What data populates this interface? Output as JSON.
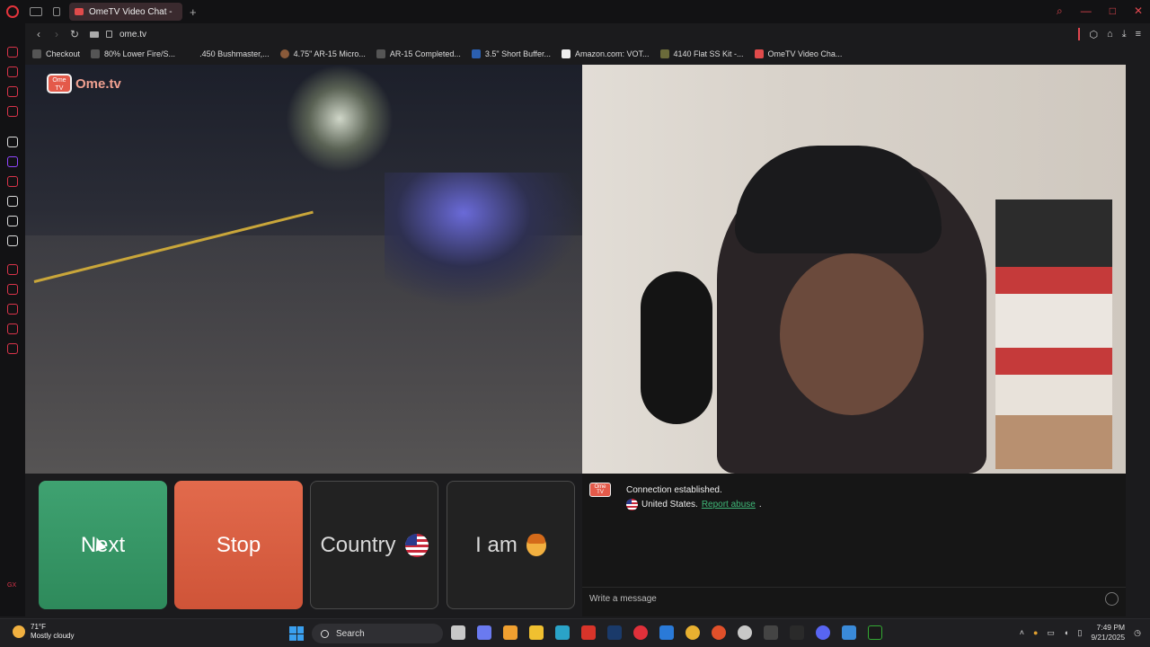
{
  "browser": {
    "tab_title": "OmeTV Video Chat -",
    "url": "ome.tv",
    "bookmarks": [
      {
        "label": "Checkout"
      },
      {
        "label": "80% Lower Fire/S..."
      },
      {
        "label": ".450 Bushmaster,..."
      },
      {
        "label": "4.75\" AR-15 Micro..."
      },
      {
        "label": "AR-15 Completed..."
      },
      {
        "label": "3.5\" Short Buffer..."
      },
      {
        "label": "Amazon.com: VOT..."
      },
      {
        "label": "4140 Flat SS Kit -..."
      },
      {
        "label": "OmeTV Video Cha..."
      }
    ]
  },
  "ome": {
    "logo_text": "Ome.tv",
    "logo_badge": "Ome TV",
    "buttons": {
      "next": "Next",
      "stop": "Stop",
      "country": "Country",
      "iam": "I am"
    },
    "chat": {
      "line1": "Connection established.",
      "country": "United States.",
      "report": "Report abuse",
      "report_suffix": ".",
      "input_placeholder": "Write a message"
    }
  },
  "taskbar": {
    "weather_temp": "71°F",
    "weather_desc": "Mostly cloudy",
    "search_label": "Search",
    "time": "7:49 PM",
    "date": "9/21/2025"
  },
  "colors": {
    "next": "#3fa271",
    "stop": "#e26a4c",
    "accent_red": "#e0474f",
    "report_link": "#3fb878"
  }
}
